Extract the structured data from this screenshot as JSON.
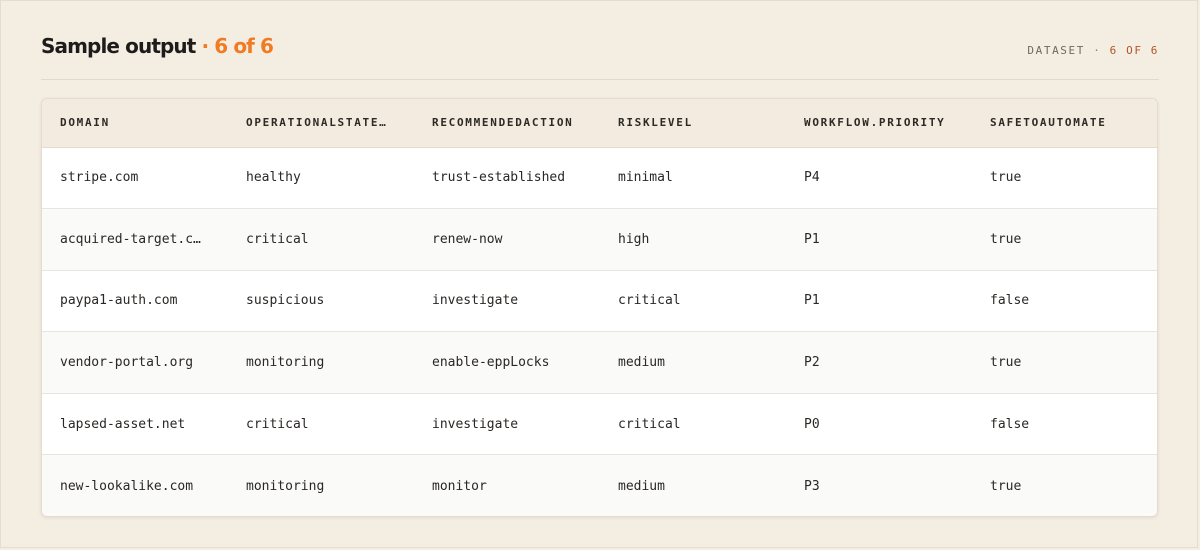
{
  "header": {
    "title": "Sample output",
    "title_separator": " · ",
    "title_count": "6 of 6",
    "dataset_label": "DATASET",
    "dataset_separator": " · ",
    "dataset_count": "6 OF 6"
  },
  "colors": {
    "accent": "#f07b22",
    "background": "#f4ede2",
    "header_row": "#f3ebdf"
  },
  "table": {
    "columns": [
      "DOMAIN",
      "OPERATIONALSTATE…",
      "RECOMMENDEDACTION",
      "RISKLEVEL",
      "WORKFLOW.PRIORITY",
      "SAFETOAUTOMATE"
    ],
    "rows": [
      [
        "stripe.com",
        "healthy",
        "trust-established",
        "minimal",
        "P4",
        "true"
      ],
      [
        "acquired-target.c…",
        "critical",
        "renew-now",
        "high",
        "P1",
        "true"
      ],
      [
        "paypa1-auth.com",
        "suspicious",
        "investigate",
        "critical",
        "P1",
        "false"
      ],
      [
        "vendor-portal.org",
        "monitoring",
        "enable-eppLocks",
        "medium",
        "P2",
        "true"
      ],
      [
        "lapsed-asset.net",
        "critical",
        "investigate",
        "critical",
        "P0",
        "false"
      ],
      [
        "new-lookalike.com",
        "monitoring",
        "monitor",
        "medium",
        "P3",
        "true"
      ]
    ]
  }
}
